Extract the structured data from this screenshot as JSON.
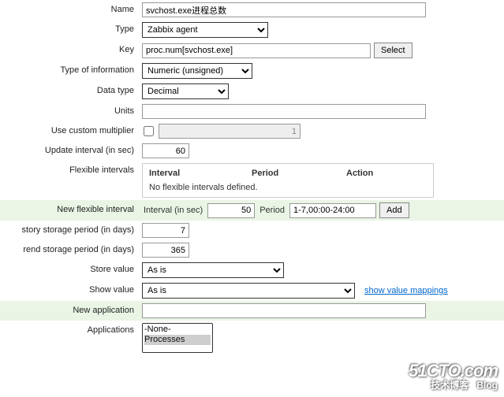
{
  "labels": {
    "name": "Name",
    "type": "Type",
    "key": "Key",
    "info": "Type of information",
    "datatype": "Data type",
    "units": "Units",
    "multiplier": "Use custom multiplier",
    "update": "Update interval (in sec)",
    "flex": "Flexible intervals",
    "newflex": "New flexible interval",
    "history": "story storage period (in days)",
    "trend": "rend storage period (in days)",
    "store": "Store value",
    "show": "Show value",
    "newapp": "New application",
    "apps": "Applications"
  },
  "values": {
    "name": "svchost.exe进程总数",
    "type": "Zabbix agent",
    "key": "proc.num[svchost.exe]",
    "info": "Numeric (unsigned)",
    "datatype": "Decimal",
    "units": "",
    "multiplier_checked": false,
    "multiplier_value": "1",
    "update": "60",
    "flex_interval": "50",
    "flex_period": "1-7,00:00-24:00",
    "history": "7",
    "trend": "365",
    "store": "As is",
    "show": "As is",
    "newapp": ""
  },
  "buttons": {
    "select": "Select",
    "add": "Add"
  },
  "flex_table": {
    "col_interval": "Interval",
    "col_period": "Period",
    "col_action": "Action",
    "empty": "No flexible intervals defined."
  },
  "newflex": {
    "interval_label": "Interval (in sec)",
    "period_label": "Period"
  },
  "links": {
    "show_value_mappings": "show value mappings"
  },
  "apps_options": [
    "-None-",
    "Processes"
  ],
  "watermark": {
    "line1": "51CTO.com",
    "line2": "技术博客",
    "line3": "Blog"
  }
}
